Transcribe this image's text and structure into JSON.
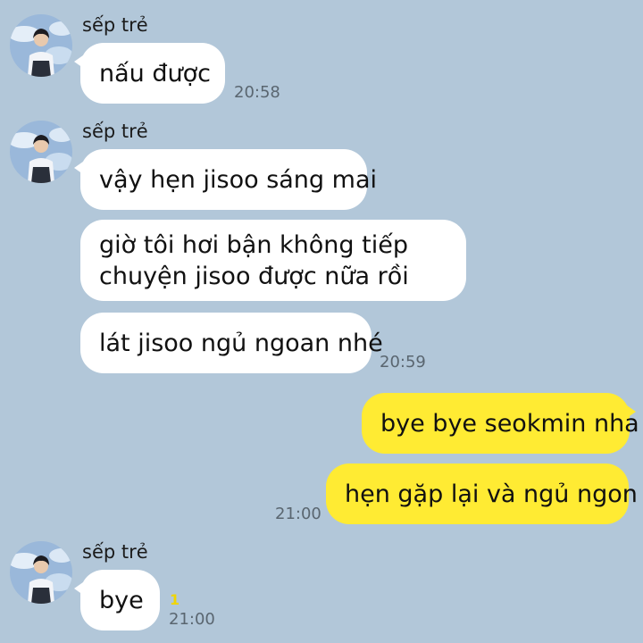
{
  "chat": {
    "background_color": "#b2c7d9",
    "incoming_bubble_color": "#ffffff",
    "outgoing_bubble_color": "#ffeb33",
    "groups": [
      {
        "sender": "sếp trẻ",
        "messages": [
          {
            "text": "nấu được",
            "time": "20:58"
          }
        ]
      },
      {
        "sender": "sếp trẻ",
        "messages": [
          {
            "text": "vậy hẹn jisoo sáng mai"
          },
          {
            "lines": [
              "giờ tôi hơi bận không tiếp",
              "chuyện jisoo được nữa rồi"
            ]
          },
          {
            "text": "lát jisoo ngủ ngoan nhé",
            "time": "20:59"
          }
        ]
      },
      {
        "sender": "sếp trẻ",
        "messages": [
          {
            "text": "bye",
            "unread": "1",
            "time": "21:00"
          }
        ]
      }
    ],
    "outgoing": [
      {
        "text": "bye bye seokmin nha"
      },
      {
        "text": "hẹn gặp lại và ngủ ngon",
        "time": "21:00"
      }
    ]
  }
}
